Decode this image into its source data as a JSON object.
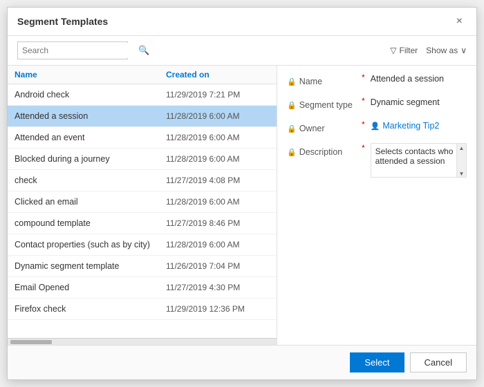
{
  "dialog": {
    "title": "Segment Templates",
    "close_label": "×"
  },
  "toolbar": {
    "search_placeholder": "Search",
    "filter_label": "Filter",
    "show_as_label": "Show as"
  },
  "list": {
    "col_name": "Name",
    "col_created": "Created on",
    "rows": [
      {
        "name": "Android check",
        "date": "11/29/2019 7:21 PM",
        "selected": false
      },
      {
        "name": "Attended a session",
        "date": "11/28/2019 6:00 AM",
        "selected": true
      },
      {
        "name": "Attended an event",
        "date": "11/28/2019 6:00 AM",
        "selected": false
      },
      {
        "name": "Blocked during a journey",
        "date": "11/28/2019 6:00 AM",
        "selected": false
      },
      {
        "name": "check",
        "date": "11/27/2019 4:08 PM",
        "selected": false
      },
      {
        "name": "Clicked an email",
        "date": "11/28/2019 6:00 AM",
        "selected": false
      },
      {
        "name": "compound template",
        "date": "11/27/2019 8:46 PM",
        "selected": false
      },
      {
        "name": "Contact properties (such as by city)",
        "date": "11/28/2019 6:00 AM",
        "selected": false
      },
      {
        "name": "Dynamic segment template",
        "date": "11/26/2019 7:04 PM",
        "selected": false
      },
      {
        "name": "Email Opened",
        "date": "11/27/2019 4:30 PM",
        "selected": false
      },
      {
        "name": "Firefox check",
        "date": "11/29/2019 12:36 PM",
        "selected": false
      }
    ]
  },
  "detail": {
    "name_label": "Name",
    "name_value": "Attended a session",
    "segment_type_label": "Segment type",
    "segment_type_value": "Dynamic segment",
    "owner_label": "Owner",
    "owner_value": "Marketing Tip2",
    "description_label": "Description",
    "description_value": "Selects contacts who attended a session"
  },
  "footer": {
    "select_label": "Select",
    "cancel_label": "Cancel"
  }
}
